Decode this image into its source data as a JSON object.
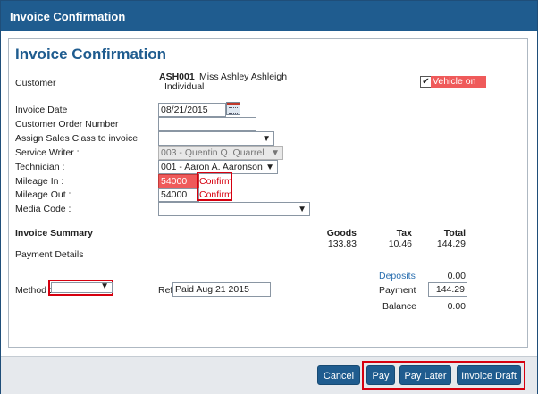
{
  "window": {
    "title": "Invoice Confirmation"
  },
  "page": {
    "heading": "Invoice Confirmation"
  },
  "customer": {
    "label": "Customer",
    "code": "ASH001",
    "name": "Miss Ashley Ashleigh",
    "type": "Individual"
  },
  "vehicle_on_site": {
    "label": "Vehicle on Site",
    "checked": true
  },
  "form": {
    "invoice_date": {
      "label": "Invoice Date",
      "value": "08/21/2015"
    },
    "customer_order_number": {
      "label": "Customer Order Number",
      "value": ""
    },
    "sales_class": {
      "label": "Assign Sales Class to invoice",
      "value": ""
    },
    "service_writer": {
      "label": "Service Writer :",
      "value": "003 - Quentin Q. Quarrel"
    },
    "technician": {
      "label": "Technician :",
      "value": "001 - Aaron A. Aaronson"
    },
    "mileage_in": {
      "label": "Mileage In :",
      "value": "54000",
      "confirm": "Confirm"
    },
    "mileage_out": {
      "label": "Mileage Out :",
      "value": "54000",
      "confirm": "Confirm"
    },
    "media_code": {
      "label": "Media Code :",
      "value": ""
    }
  },
  "summary": {
    "title": "Invoice Summary",
    "headers": {
      "goods": "Goods",
      "tax": "Tax",
      "total": "Total"
    },
    "values": {
      "goods": "133.83",
      "tax": "10.46",
      "total": "144.29"
    },
    "payment_details": "Payment Details"
  },
  "payment": {
    "deposits_label": "Deposits",
    "deposits_value": "0.00",
    "method_label": "Method :",
    "method_value": "",
    "ref_label": "Ref",
    "ref_value": "Paid Aug 21 2015",
    "payment_label": "Payment",
    "payment_value": "144.29",
    "balance_label": "Balance",
    "balance_value": "0.00"
  },
  "buttons": {
    "cancel": "Cancel",
    "pay": "Pay",
    "pay_later": "Pay Later",
    "invoice_draft": "Invoice Draft"
  },
  "colors": {
    "title_bar": "#1f5c8f",
    "highlight": "#d6000f",
    "mileage_error_bg": "#ef5a5a"
  }
}
